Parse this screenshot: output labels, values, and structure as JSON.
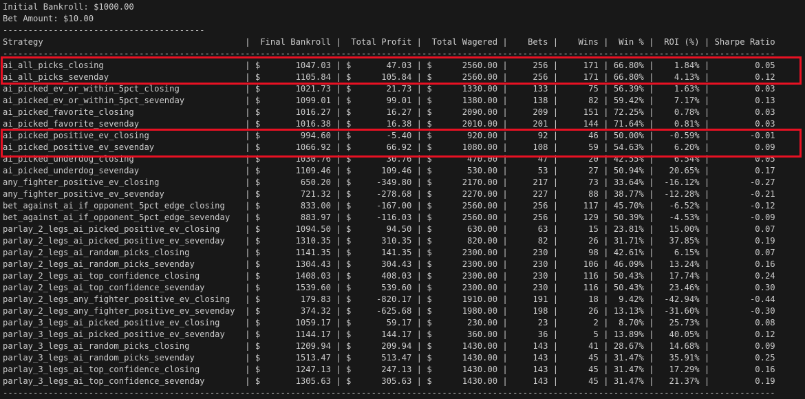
{
  "info": {
    "initial_bankroll": "Initial Bankroll: $1000.00",
    "bet_amount": "Bet Amount: $10.00",
    "rule_top": "----------------------------------------"
  },
  "headers": [
    "Strategy",
    "Final Bankroll",
    "Total Profit",
    "Total Wagered",
    "Bets",
    "Wins",
    "Win %",
    "ROI (%)",
    "Sharpe Ratio"
  ],
  "rows": [
    [
      "ai_all_picks_closing",
      "1047.03",
      "47.03",
      "2560.00",
      "256",
      "171",
      "66.80%",
      "1.84%",
      "0.05"
    ],
    [
      "ai_all_picks_sevenday",
      "1105.84",
      "105.84",
      "2560.00",
      "256",
      "171",
      "66.80%",
      "4.13%",
      "0.12"
    ],
    [
      "ai_picked_ev_or_within_5pct_closing",
      "1021.73",
      "21.73",
      "1330.00",
      "133",
      "75",
      "56.39%",
      "1.63%",
      "0.03"
    ],
    [
      "ai_picked_ev_or_within_5pct_sevenday",
      "1099.01",
      "99.01",
      "1380.00",
      "138",
      "82",
      "59.42%",
      "7.17%",
      "0.13"
    ],
    [
      "ai_picked_favorite_closing",
      "1016.27",
      "16.27",
      "2090.00",
      "209",
      "151",
      "72.25%",
      "0.78%",
      "0.03"
    ],
    [
      "ai_picked_favorite_sevenday",
      "1016.38",
      "16.38",
      "2010.00",
      "201",
      "144",
      "71.64%",
      "0.81%",
      "0.03"
    ],
    [
      "ai_picked_positive_ev_closing",
      "994.60",
      "-5.40",
      "920.00",
      "92",
      "46",
      "50.00%",
      "-0.59%",
      "-0.01"
    ],
    [
      "ai_picked_positive_ev_sevenday",
      "1066.92",
      "66.92",
      "1080.00",
      "108",
      "59",
      "54.63%",
      "6.20%",
      "0.09"
    ],
    [
      "ai_picked_underdog_closing",
      "1030.76",
      "30.76",
      "470.00",
      "47",
      "20",
      "42.55%",
      "6.54%",
      "0.05"
    ],
    [
      "ai_picked_underdog_sevenday",
      "1109.46",
      "109.46",
      "530.00",
      "53",
      "27",
      "50.94%",
      "20.65%",
      "0.17"
    ],
    [
      "any_fighter_positive_ev_closing",
      "650.20",
      "-349.80",
      "2170.00",
      "217",
      "73",
      "33.64%",
      "-16.12%",
      "-0.27"
    ],
    [
      "any_fighter_positive_ev_sevenday",
      "721.32",
      "-278.68",
      "2270.00",
      "227",
      "88",
      "38.77%",
      "-12.28%",
      "-0.21"
    ],
    [
      "bet_against_ai_if_opponent_5pct_edge_closing",
      "833.00",
      "-167.00",
      "2560.00",
      "256",
      "117",
      "45.70%",
      "-6.52%",
      "-0.12"
    ],
    [
      "bet_against_ai_if_opponent_5pct_edge_sevenday",
      "883.97",
      "-116.03",
      "2560.00",
      "256",
      "129",
      "50.39%",
      "-4.53%",
      "-0.09"
    ],
    [
      "parlay_2_legs_ai_picked_positive_ev_closing",
      "1094.50",
      "94.50",
      "630.00",
      "63",
      "15",
      "23.81%",
      "15.00%",
      "0.07"
    ],
    [
      "parlay_2_legs_ai_picked_positive_ev_sevenday",
      "1310.35",
      "310.35",
      "820.00",
      "82",
      "26",
      "31.71%",
      "37.85%",
      "0.19"
    ],
    [
      "parlay_2_legs_ai_random_picks_closing",
      "1141.35",
      "141.35",
      "2300.00",
      "230",
      "98",
      "42.61%",
      "6.15%",
      "0.07"
    ],
    [
      "parlay_2_legs_ai_random_picks_sevenday",
      "1304.43",
      "304.43",
      "2300.00",
      "230",
      "106",
      "46.09%",
      "13.24%",
      "0.16"
    ],
    [
      "parlay_2_legs_ai_top_confidence_closing",
      "1408.03",
      "408.03",
      "2300.00",
      "230",
      "116",
      "50.43%",
      "17.74%",
      "0.24"
    ],
    [
      "parlay_2_legs_ai_top_confidence_sevenday",
      "1539.60",
      "539.60",
      "2300.00",
      "230",
      "116",
      "50.43%",
      "23.46%",
      "0.30"
    ],
    [
      "parlay_2_legs_any_fighter_positive_ev_closing",
      "179.83",
      "-820.17",
      "1910.00",
      "191",
      "18",
      "9.42%",
      "-42.94%",
      "-0.44"
    ],
    [
      "parlay_2_legs_any_fighter_positive_ev_sevenday",
      "374.32",
      "-625.68",
      "1980.00",
      "198",
      "26",
      "13.13%",
      "-31.60%",
      "-0.30"
    ],
    [
      "parlay_3_legs_ai_picked_positive_ev_closing",
      "1059.17",
      "59.17",
      "230.00",
      "23",
      "2",
      "8.70%",
      "25.73%",
      "0.08"
    ],
    [
      "parlay_3_legs_ai_picked_positive_ev_sevenday",
      "1144.17",
      "144.17",
      "360.00",
      "36",
      "5",
      "13.89%",
      "40.05%",
      "0.12"
    ],
    [
      "parlay_3_legs_ai_random_picks_closing",
      "1209.94",
      "209.94",
      "1430.00",
      "143",
      "41",
      "28.67%",
      "14.68%",
      "0.09"
    ],
    [
      "parlay_3_legs_ai_random_picks_sevenday",
      "1513.47",
      "513.47",
      "1430.00",
      "143",
      "45",
      "31.47%",
      "35.91%",
      "0.25"
    ],
    [
      "parlay_3_legs_ai_top_confidence_closing",
      "1247.13",
      "247.13",
      "1430.00",
      "143",
      "45",
      "31.47%",
      "17.29%",
      "0.16"
    ],
    [
      "parlay_3_legs_ai_top_confidence_sevenday",
      "1305.63",
      "305.63",
      "1430.00",
      "143",
      "45",
      "31.47%",
      "21.37%",
      "0.19"
    ]
  ],
  "highlight_color": "#e81123"
}
